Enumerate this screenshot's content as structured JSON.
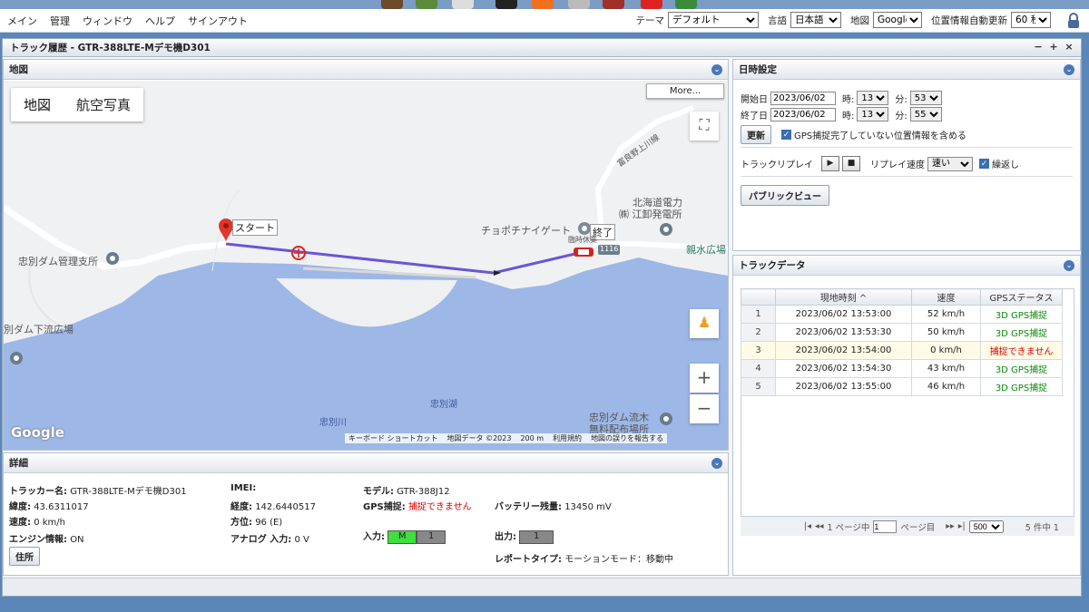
{
  "menu": [
    "メイン",
    "管理",
    "ウィンドウ",
    "ヘルプ",
    "サインアウト"
  ],
  "settings": {
    "theme_label": "テーマ",
    "theme_value": "デフォルト",
    "lang_label": "言語",
    "lang_value": "日本語",
    "map_label": "地図",
    "map_value": "Google",
    "refresh_label": "位置情報自動更新",
    "refresh_value": "60 秒"
  },
  "window": {
    "title": "トラック履歴 - GTR-388LTE-Mデモ機D301",
    "controls": [
      "−",
      "+",
      "×"
    ]
  },
  "map_panel": {
    "title": "地図",
    "map_type": [
      "地図",
      "航空写真"
    ],
    "more": "More...",
    "labels": {
      "start": "スタート",
      "end": "終了",
      "kitahoku": "北海道電力",
      "kitahoku2": "㈱ 江卸発電所",
      "chopochi": "チョポチナイゲート",
      "rest": "臨時休業",
      "road": "1116",
      "shinsui": "親水広場",
      "dam_office": "忠別ダム管理支所",
      "downstream": "別ダム下流広場",
      "lake": "忠別湖",
      "river": "忠別川",
      "driftwood": "忠別ダム流木",
      "driftwood2": "無料配布場所",
      "upper_river": "富良野上川線",
      "google": "Google"
    },
    "attribution": [
      "キーボード ショートカット",
      "地図データ ©2023",
      "200 m",
      "利用規約",
      "地図の誤りを報告する"
    ],
    "zoom_in": "+",
    "zoom_out": "−"
  },
  "details": {
    "title": "詳細",
    "tracker_label": "トラッカー名:",
    "tracker_value": "GTR-388LTE-Mデモ機D301",
    "imei_label": "IMEI:",
    "imei_value": "",
    "model_label": "モデル:",
    "model_value": "GTR-388J12",
    "lat_label": "緯度:",
    "lat_value": "43.6311017",
    "lon_label": "経度:",
    "lon_value": "142.6440517",
    "gps_label": "GPS捕捉:",
    "gps_value": "捕捉できません",
    "battery_label": "バッテリー残量:",
    "battery_value": "13450 mV",
    "speed_label": "速度:",
    "speed_value": "0 km/h",
    "dir_label": "方位:",
    "dir_value": "96 (E)",
    "engine_label": "エンジン情報:",
    "engine_value": "ON",
    "analog_label": "アナログ 入力:",
    "analog_value": "0 V",
    "input_label": "入力:",
    "input_m": "M",
    "input_1": "1",
    "output_label": "出力:",
    "output_1": "1",
    "address_btn": "住所",
    "report_label": "レポートタイプ:",
    "report_value": "モーションモード：移動中"
  },
  "datetime": {
    "title": "日時設定",
    "start_label": "開始日",
    "start_date": "2023/06/02",
    "start_hour": "13",
    "start_min": "53",
    "end_label": "終了日",
    "end_date": "2023/06/02",
    "end_hour": "13",
    "end_min": "55",
    "hour_label": "時:",
    "min_label": "分:",
    "update_btn": "更新",
    "include_label": "GPS捕捉完了していない位置情報を含める",
    "replay_label": "トラックリプレイ",
    "replay_speed_label": "リプレイ速度",
    "replay_speed": "速い",
    "repeat_label": "繰返し",
    "public_btn": "パブリックビュー"
  },
  "trackdata": {
    "title": "トラックデータ",
    "columns": [
      "現地時刻 ^",
      "速度",
      "GPSステータス"
    ],
    "rows": [
      {
        "idx": "1",
        "time": "2023/06/02 13:53:00",
        "speed": "52 km/h",
        "status": "3D GPS捕捉"
      },
      {
        "idx": "2",
        "time": "2023/06/02 13:53:30",
        "speed": "50 km/h",
        "status": "3D GPS捕捉"
      },
      {
        "idx": "3",
        "time": "2023/06/02 13:54:00",
        "speed": "0 km/h",
        "status": "捕捉できません"
      },
      {
        "idx": "4",
        "time": "2023/06/02 13:54:30",
        "speed": "43 km/h",
        "status": "3D GPS捕捉"
      },
      {
        "idx": "5",
        "time": "2023/06/02 13:55:00",
        "speed": "46 km/h",
        "status": "3D GPS捕捉"
      }
    ],
    "pager": {
      "page_prefix": "1 ページ中",
      "page": "1",
      "page_suffix": "ページ目",
      "size": "500",
      "count": "5 件中 1"
    }
  },
  "colors": {
    "route": "#6a55d8",
    "water": "#9ab6e8",
    "marker": "#e0362c",
    "ok": "#0a8a0a",
    "ng": "#d00000"
  }
}
